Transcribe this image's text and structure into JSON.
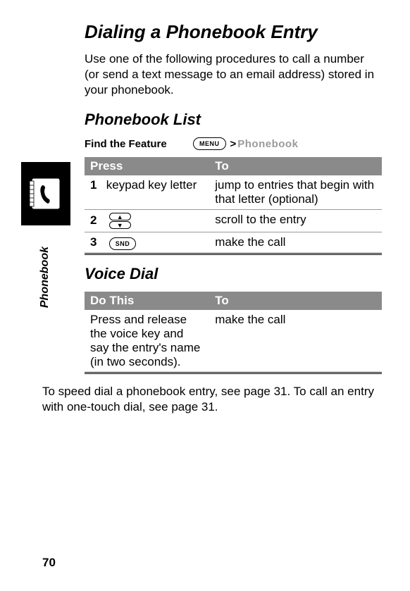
{
  "sideLabel": "Phonebook",
  "title": "Dialing a Phonebook Entry",
  "intro": "Use one of the following procedures to call a number (or send a text message to an email address) stored in your phonebook.",
  "section1": {
    "heading": "Phonebook List",
    "findLabel": "Find the Feature",
    "menuKey": "MENU",
    "sep": ">",
    "breadcrumb": "Phonebook",
    "table": {
      "head1": "Press",
      "head2": "To",
      "rows": [
        {
          "num": "1",
          "press": "keypad key letter",
          "to": "jump to entries that begin with that letter (optional)"
        },
        {
          "num": "2",
          "press": "",
          "to": "scroll to the entry",
          "navKeys": true
        },
        {
          "num": "3",
          "press": "",
          "to": "make the call",
          "sndKey": "SND"
        }
      ]
    }
  },
  "section2": {
    "heading": "Voice Dial",
    "table": {
      "head1": "Do This",
      "head2": "To",
      "rows": [
        {
          "do": "Press and release the voice key and say the entry's name (in two seconds).",
          "to": "make the call"
        }
      ]
    }
  },
  "footer": "To speed dial a phonebook entry, see page 31. To call an entry with one-touch dial, see page 31.",
  "pageNum": "70"
}
